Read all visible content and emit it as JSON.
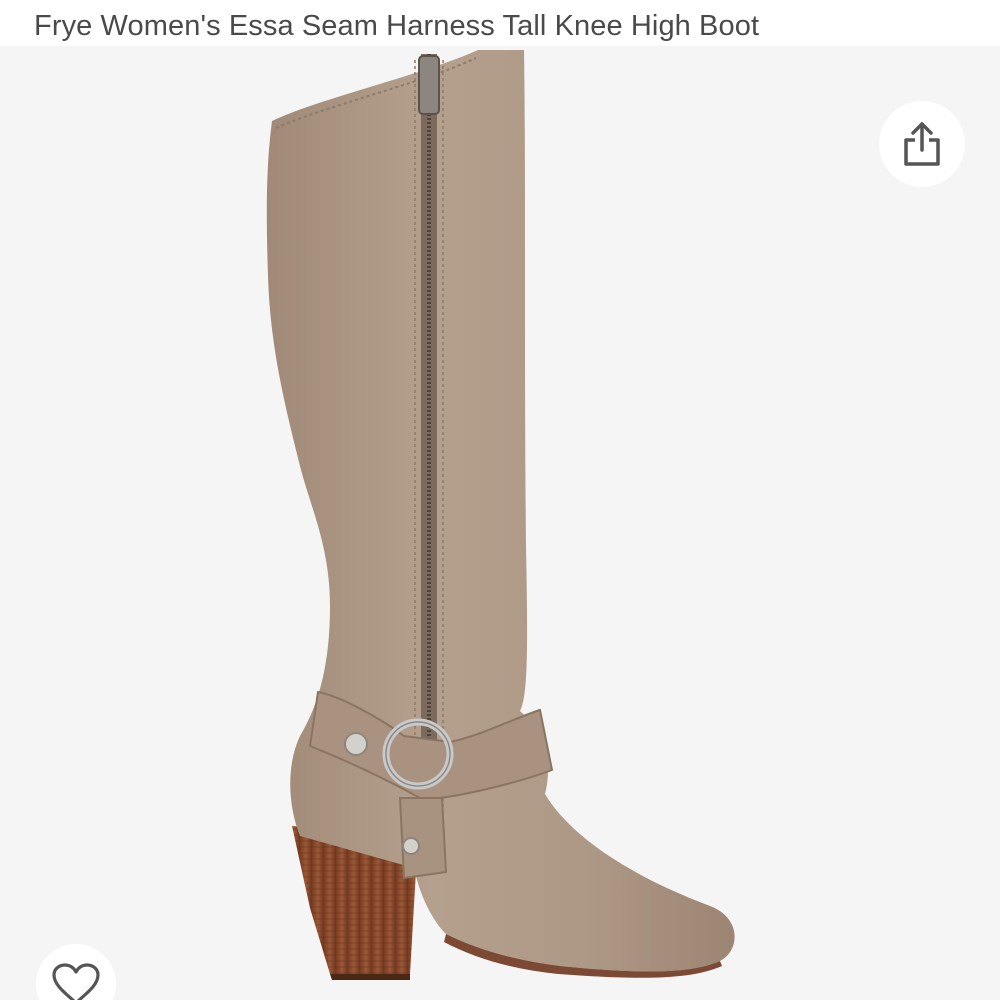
{
  "product": {
    "title": "Frye Women's Essa Seam Harness Tall Knee High Boot"
  },
  "actions": {
    "share_icon": "share-icon",
    "wishlist_icon": "heart-outline-icon"
  },
  "colors": {
    "suede": "#b09a88",
    "heel_wood": "#8a4a2c",
    "background": "#f5f5f5",
    "icon_gray": "#555555"
  }
}
